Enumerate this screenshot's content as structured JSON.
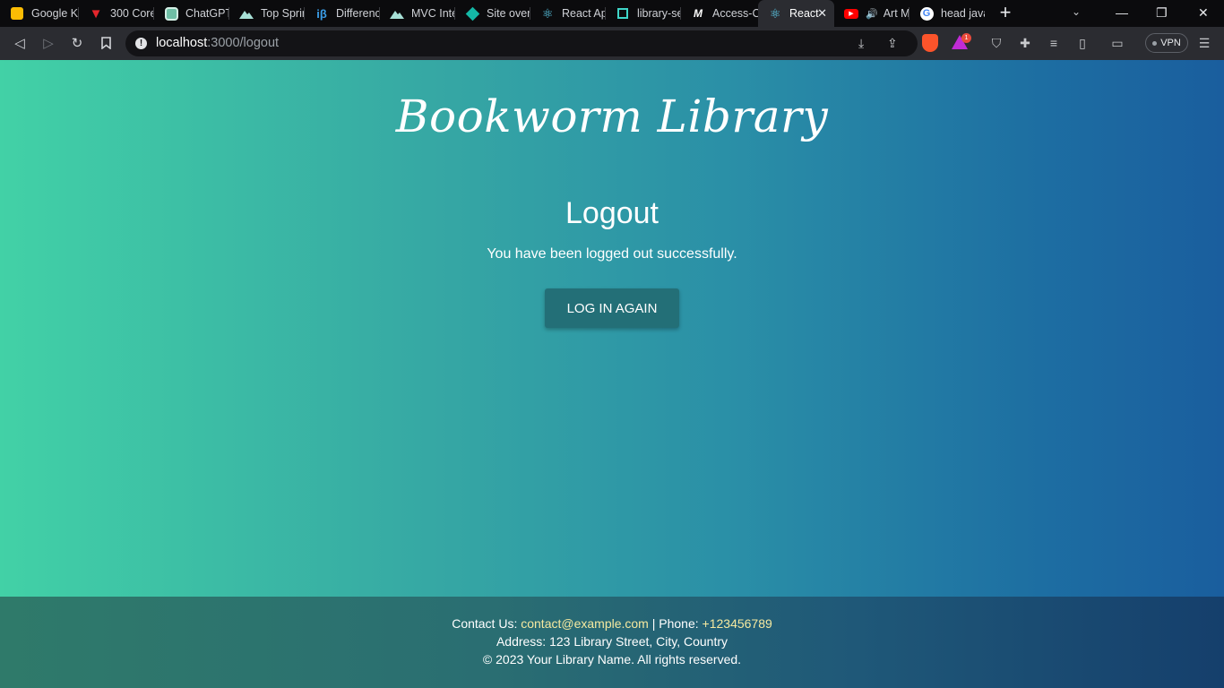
{
  "browser": {
    "tabs": [
      {
        "label": "Google K",
        "icon": "google-keep-icon",
        "color": "#fbbc04"
      },
      {
        "label": "300 Core",
        "icon": "vivaldi-red-icon",
        "color": "#e4262c"
      },
      {
        "label": "ChatGPT",
        "icon": "chatgpt-icon",
        "color": "#10a37f"
      },
      {
        "label": "Top Sprin",
        "icon": "mountain-icon",
        "color": "#a7e0d6"
      },
      {
        "label": "Differenc",
        "icon": "ib-icon",
        "color": "#3b9ee8"
      },
      {
        "label": "MVC Inte",
        "icon": "mountain-icon",
        "color": "#a7e0d6"
      },
      {
        "label": "Site over",
        "icon": "diamond-icon",
        "color": "#14b8a6"
      },
      {
        "label": "React Ap",
        "icon": "react-icon",
        "color": "#61dafb"
      },
      {
        "label": "library-se",
        "icon": "codesandbox-icon",
        "color": "#3fd5c8"
      },
      {
        "label": "Access-C",
        "icon": "medium-icon",
        "color": "#ffffff"
      },
      {
        "label": "React",
        "icon": "react-icon",
        "color": "#61dafb",
        "active": true
      },
      {
        "label": "Art M",
        "icon": "youtube-icon",
        "color": "#ff0000"
      },
      {
        "label": "head java",
        "icon": "google-icon",
        "color": "#4285f4"
      }
    ],
    "new_tab": "+",
    "url_host": "localhost",
    "url_path": ":3000/logout",
    "vpn_label": "VPN",
    "rewards_count": "1"
  },
  "page": {
    "brand": "Bookworm Library",
    "heading": "Logout",
    "message": "You have been logged out successfully.",
    "button_label": "LOG IN AGAIN"
  },
  "footer": {
    "contact_prefix": "Contact Us: ",
    "email": "contact@example.com",
    "phone_prefix": " | Phone: ",
    "phone": "+123456789",
    "address": "Address: 123 Library Street, City, Country",
    "copyright": "© 2023 Your Library Name. All rights reserved."
  }
}
